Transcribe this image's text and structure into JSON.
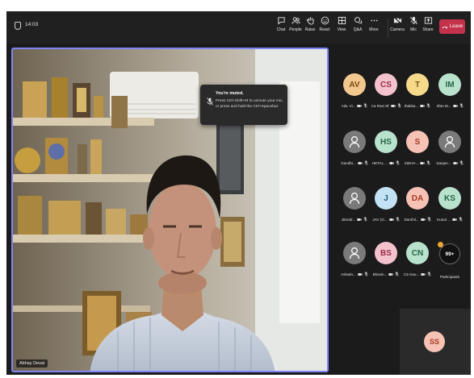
{
  "header": {
    "timer": "14:03",
    "controls": [
      {
        "label": "Chat",
        "icon": "chat-icon"
      },
      {
        "label": "People",
        "icon": "people-icon"
      },
      {
        "label": "Raise",
        "icon": "raise-hand-icon"
      },
      {
        "label": "React",
        "icon": "react-icon"
      },
      {
        "label": "View",
        "icon": "view-icon"
      },
      {
        "label": "Q&A",
        "icon": "qa-icon"
      },
      {
        "label": "More",
        "icon": "more-icon"
      },
      {
        "label": "Camera",
        "icon": "camera-icon"
      },
      {
        "label": "Mic",
        "icon": "mic-muted-icon"
      },
      {
        "label": "Share",
        "icon": "share-icon"
      }
    ],
    "leave_label": "Leave"
  },
  "toast": {
    "title": "You're muted.",
    "body": "Press Ctrl+Shift+M to unmute your mic, or press and hold the Ctrl+Spacebar."
  },
  "main_video": {
    "speaker_name": "Abhay Desai"
  },
  "participants": [
    {
      "initials": "AV",
      "name": "Adv. Vi...",
      "color": "#f2c88e",
      "text_color": "#7a4a16"
    },
    {
      "initials": "CS",
      "name": "Ca Ravi Sh...",
      "color": "#f3c2cc",
      "text_color": "#9b2c49"
    },
    {
      "initials": "T",
      "name": "thakka...",
      "color": "#f7d98c",
      "text_color": "#7a5a10"
    },
    {
      "initials": "IM",
      "name": "Irfan M...",
      "color": "#b9e2cc",
      "text_color": "#256647"
    },
    {
      "initials": "",
      "name": "Gandhi...",
      "color": "#7a7a7a",
      "text_color": "#ffffff"
    },
    {
      "initials": "HS",
      "name": "HETAL ...",
      "color": "#b9e2cc",
      "text_color": "#256647"
    },
    {
      "initials": "S",
      "name": "SIDHA...",
      "color": "#f6c2b5",
      "text_color": "#a63a22"
    },
    {
      "initials": "",
      "name": "Sanjee...",
      "color": "#7a7a7a",
      "text_color": "#ffffff"
    },
    {
      "initials": "",
      "name": "Jitendr...",
      "color": "#7a7a7a",
      "text_color": "#ffffff"
    },
    {
      "initials": "J",
      "name": "JAV (G...",
      "color": "#c3e2f3",
      "text_color": "#1f5a85"
    },
    {
      "initials": "DA",
      "name": "Darshil...",
      "color": "#f6c2b5",
      "text_color": "#a63a22"
    },
    {
      "initials": "KS",
      "name": "Kunal ...",
      "color": "#b9e2cc",
      "text_color": "#256647"
    },
    {
      "initials": "",
      "name": "Ashwin...",
      "color": "#7a7a7a",
      "text_color": "#ffffff"
    },
    {
      "initials": "BS",
      "name": "Bhavin...",
      "color": "#f3c2cc",
      "text_color": "#9b2c49"
    },
    {
      "initials": "CN",
      "name": "CS Kau...",
      "color": "#b9e2cc",
      "text_color": "#256647"
    }
  ],
  "more_participants": {
    "count": "99+",
    "label": "Participants"
  },
  "self_view": {
    "initials": "SS",
    "color": "#f6c2b5",
    "text_color": "#a63a22"
  }
}
